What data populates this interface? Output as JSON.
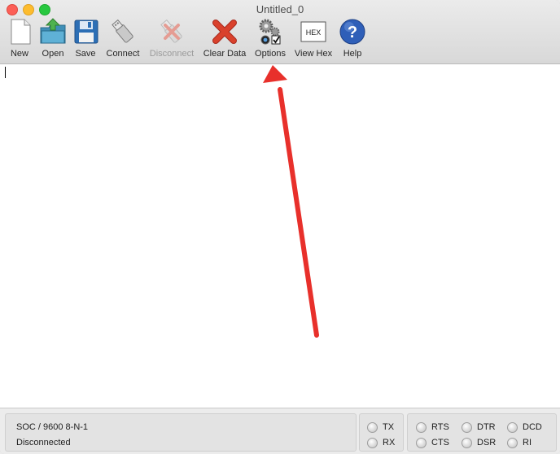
{
  "window": {
    "title": "Untitled_0"
  },
  "toolbar": {
    "new": "New",
    "open": "Open",
    "save": "Save",
    "connect": "Connect",
    "disconnect": "Disconnect",
    "clear_data": "Clear Data",
    "options": "Options",
    "view_hex": "View Hex",
    "hex_icon_text": "HEX",
    "help": "Help"
  },
  "status": {
    "port_settings": "SOC / 9600 8-N-1",
    "connection": "Disconnected"
  },
  "indicators": {
    "tx": "TX",
    "rx": "RX",
    "rts": "RTS",
    "cts": "CTS",
    "dtr": "DTR",
    "dsr": "DSR",
    "dcd": "DCD",
    "ri": "RI"
  },
  "colors": {
    "annotation_arrow": "#e8302b",
    "help_icon": "#2f5fb8",
    "clear_icon": "#d9412c"
  }
}
